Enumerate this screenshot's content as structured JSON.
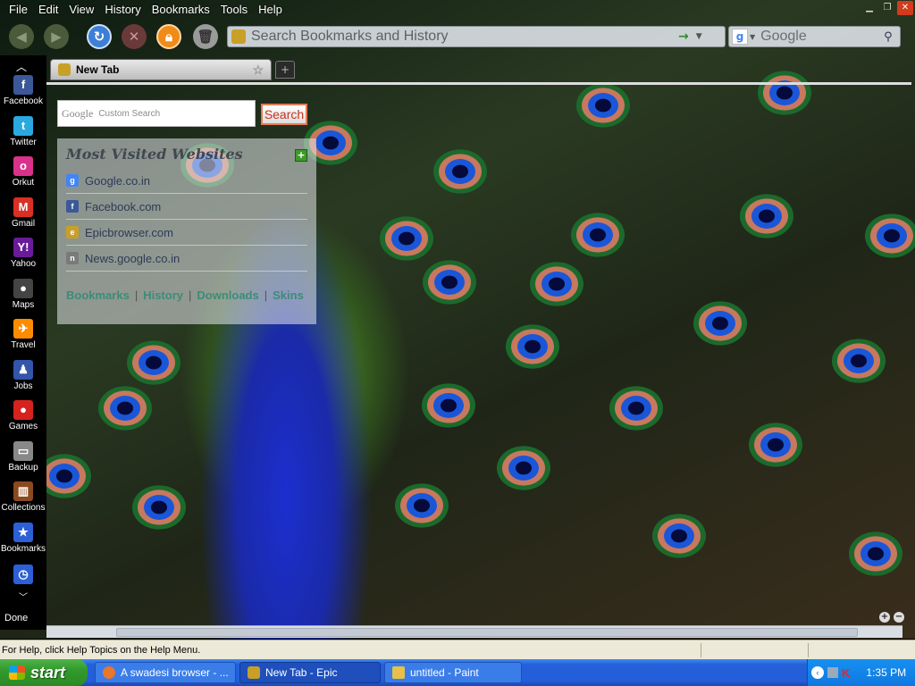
{
  "menubar": {
    "items": [
      {
        "label": "File"
      },
      {
        "label": "Edit"
      },
      {
        "label": "View"
      },
      {
        "label": "History"
      },
      {
        "label": "Bookmarks"
      },
      {
        "label": "Tools"
      },
      {
        "label": "Help"
      }
    ]
  },
  "navbar": {
    "url_placeholder": "Search Bookmarks and History",
    "search_placeholder": "Google"
  },
  "sidebar": {
    "items": [
      {
        "label": "Facebook",
        "icon": "facebook-icon",
        "color": "#3b5998",
        "glyph": "f"
      },
      {
        "label": "Twitter",
        "icon": "twitter-icon",
        "color": "#2aa9e0",
        "glyph": "t"
      },
      {
        "label": "Orkut",
        "icon": "orkut-icon",
        "color": "#d8328a",
        "glyph": "o"
      },
      {
        "label": "Gmail",
        "icon": "gmail-icon",
        "color": "#d93025",
        "glyph": "M"
      },
      {
        "label": "Yahoo",
        "icon": "yahoo-icon",
        "color": "#6a1b9a",
        "glyph": "Y!"
      },
      {
        "label": "Maps",
        "icon": "traffic-light-icon",
        "color": "#444444",
        "glyph": "●"
      },
      {
        "label": "Travel",
        "icon": "airplane-icon",
        "color": "#ff8c00",
        "glyph": "✈"
      },
      {
        "label": "Jobs",
        "icon": "person-icon",
        "color": "#3355aa",
        "glyph": "♟"
      },
      {
        "label": "Games",
        "icon": "mushroom-icon",
        "color": "#d6231e",
        "glyph": "●"
      },
      {
        "label": "Backup",
        "icon": "drive-icon",
        "color": "#888888",
        "glyph": "▭"
      },
      {
        "label": "Collections",
        "icon": "books-icon",
        "color": "#8a4a20",
        "glyph": "▥"
      },
      {
        "label": "Bookmarks",
        "icon": "star-icon",
        "color": "#2d5fd6",
        "glyph": "★"
      }
    ],
    "status": "Done"
  },
  "tabs": {
    "active_label": "New Tab"
  },
  "content": {
    "google_placeholder": "Custom Search",
    "google_button": "Search",
    "most_visited_title": "Most Visited Websites",
    "links": [
      {
        "label": "Google.co.in",
        "icon": "google-favicon",
        "color": "#4285f4",
        "glyph": "g"
      },
      {
        "label": "Facebook.com",
        "icon": "facebook-favicon",
        "color": "#3b5998",
        "glyph": "f"
      },
      {
        "label": "Epicbrowser.com",
        "icon": "epic-favicon",
        "color": "#c8a028",
        "glyph": "e"
      },
      {
        "label": "News.google.co.in",
        "icon": "news-favicon",
        "color": "#7a7a7a",
        "glyph": "n"
      }
    ],
    "footer_links": [
      "Bookmarks",
      "History",
      "Downloads",
      "Skins"
    ]
  },
  "paint_status": "For Help, click Help Topics on the Help Menu.",
  "taskbar": {
    "start_label": "start",
    "items": [
      {
        "label": "A swadesi browser - ...",
        "icon": "firefox-icon",
        "color": "#e8762d"
      },
      {
        "label": "New Tab - Epic",
        "icon": "epic-icon",
        "color": "#c8a028"
      },
      {
        "label": "untitled - Paint",
        "icon": "paint-icon",
        "color": "#e6c04a"
      }
    ],
    "clock": "1:35 PM"
  }
}
